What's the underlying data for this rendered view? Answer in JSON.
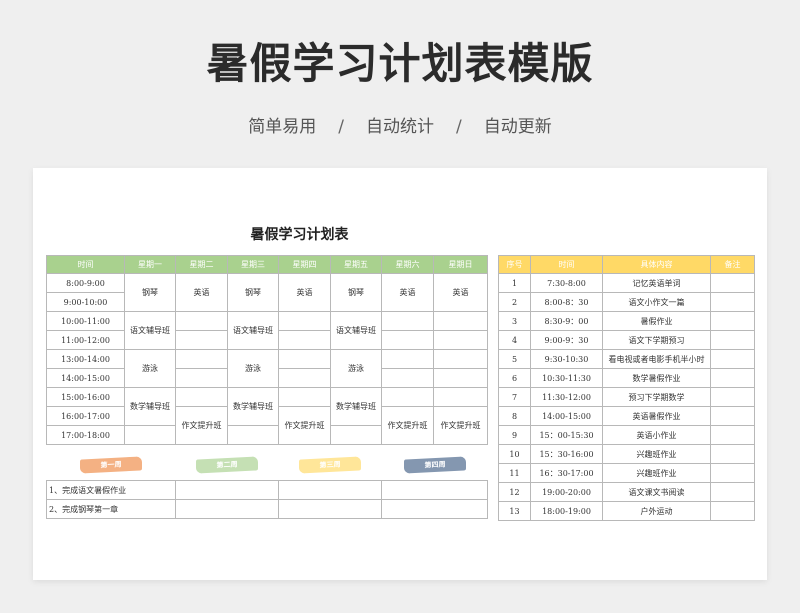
{
  "hero": {
    "title": "暑假学习计划表模版",
    "subtitle": [
      "简单易用",
      "自动统计",
      "自动更新"
    ],
    "separator": "/"
  },
  "sheet": {
    "title": "暑假学习计划表",
    "schedule": {
      "header_color": "#a9d18e",
      "headers": [
        "时间",
        "星期一",
        "星期二",
        "星期三",
        "星期四",
        "星期五",
        "星期六",
        "星期日"
      ],
      "times": [
        "8:00-9:00",
        "9:00-10:00",
        "10:00-11:00",
        "11:00-12:00",
        "13:00-14:00",
        "14:00-15:00",
        "15:00-16:00",
        "16:00-17:00",
        "17:00-18:00"
      ],
      "piano": "钢琴",
      "english": "英语",
      "chinese_tutor": "语文辅导班",
      "swim": "游泳",
      "math_tutor": "数学辅导班",
      "writing": "作文提升班"
    },
    "weeks": {
      "labels": [
        "第一周",
        "第二周",
        "第三周",
        "第四周"
      ],
      "colors": [
        "#f4b183",
        "#c5e0b4",
        "#ffe699",
        "#8497b0"
      ],
      "tasks": [
        "1、完成语文暑假作业",
        "2、完成钢琴第一章"
      ]
    },
    "daily": {
      "header_color": "#ffd966",
      "headers": [
        "序号",
        "时间",
        "具体内容",
        "备注"
      ],
      "rows": [
        {
          "no": "1",
          "time": "7:30-8:00",
          "content": "记忆英语单词",
          "note": ""
        },
        {
          "no": "2",
          "time": "8:00-8：30",
          "content": "语文小作文一篇",
          "note": ""
        },
        {
          "no": "3",
          "time": "8:30-9：00",
          "content": "暑假作业",
          "note": ""
        },
        {
          "no": "4",
          "time": "9:00-9：30",
          "content": "语文下学期预习",
          "note": ""
        },
        {
          "no": "5",
          "time": "9:30-10:30",
          "content": "看电视或者电影手机半小时",
          "note": ""
        },
        {
          "no": "6",
          "time": "10:30-11:30",
          "content": "数学暑假作业",
          "note": ""
        },
        {
          "no": "7",
          "time": "11:30-12:00",
          "content": "预习下学期数学",
          "note": ""
        },
        {
          "no": "8",
          "time": "14:00-15:00",
          "content": "英语暑假作业",
          "note": ""
        },
        {
          "no": "9",
          "time": "15：00-15:30",
          "content": "英语小作业",
          "note": ""
        },
        {
          "no": "10",
          "time": "15：30-16:00",
          "content": "兴趣班作业",
          "note": ""
        },
        {
          "no": "11",
          "time": "16：30-17:00",
          "content": "兴趣班作业",
          "note": ""
        },
        {
          "no": "12",
          "time": "19:00-20:00",
          "content": "语文课文书阅读",
          "note": ""
        },
        {
          "no": "13",
          "time": "18:00-19:00",
          "content": "户外运动",
          "note": ""
        }
      ]
    }
  }
}
